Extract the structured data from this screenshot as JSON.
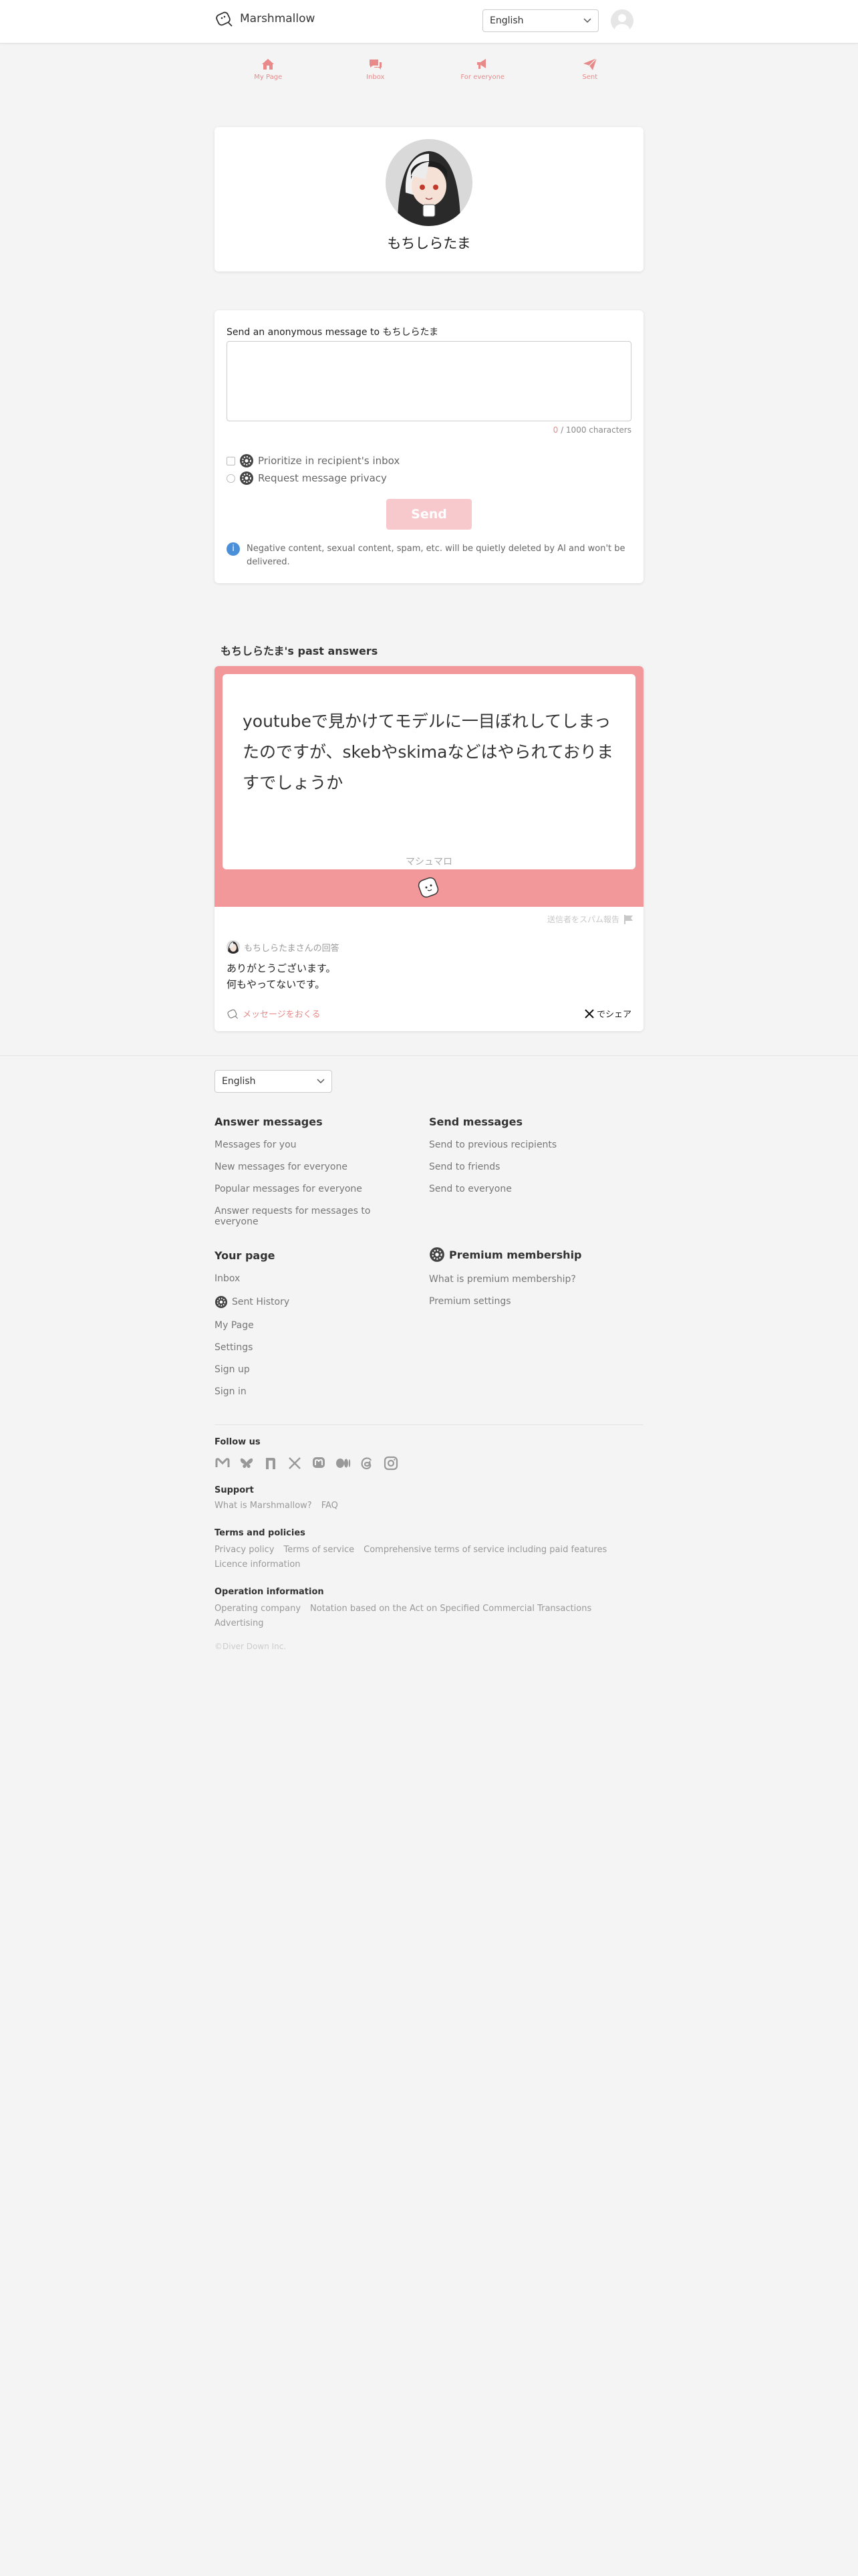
{
  "header": {
    "brand": "Marshmallow",
    "language": "English"
  },
  "tabs": [
    {
      "label": "My Page",
      "icon": "home-icon"
    },
    {
      "label": "Inbox",
      "icon": "inbox-icon"
    },
    {
      "label": "For everyone",
      "icon": "megaphone-icon"
    },
    {
      "label": "Sent",
      "icon": "send-icon"
    }
  ],
  "profile": {
    "name": "もちしらたま"
  },
  "form": {
    "label": "Send an anonymous message to もちしらたま",
    "textarea_value": "",
    "char_count": "0",
    "char_suffix": " / 1000 characters",
    "option_priority": "Prioritize in recipient's inbox",
    "option_privacy": "Request message privacy",
    "send_label": "Send",
    "notice": "Negative content, sexual content, spam, etc. will be quietly deleted by AI and won't be delivered."
  },
  "answers": {
    "section_title": "もちしらたま's past answers",
    "message": "youtubeで見かけてモデルに一目ぼれしてしまったのですが、skebやskimaなどはやられておりますでしょうか",
    "card_brand": "マシュマロ",
    "report_label": "送信者をスパム報告",
    "answerer_label": "もちしらたまさんの回答",
    "answer_text": "ありがとうございます。\n何もやってないです。",
    "reply_label": "メッセージをおくる",
    "share_label": "でシェア"
  },
  "footer": {
    "language": "English",
    "answer_messages": {
      "title": "Answer messages",
      "links": [
        "Messages for you",
        "New messages for everyone",
        "Popular messages for everyone",
        "Answer requests for messages to everyone"
      ]
    },
    "send_messages": {
      "title": "Send messages",
      "links": [
        "Send to previous recipients",
        "Send to friends",
        "Send to everyone"
      ]
    },
    "your_page": {
      "title": "Your page",
      "links": [
        "Inbox",
        "Sent History",
        "My Page",
        "Settings",
        "Sign up",
        "Sign in"
      ]
    },
    "premium": {
      "title": "Premium membership",
      "links": [
        "What is premium membership?",
        "Premium settings"
      ]
    },
    "follow_us": "Follow us",
    "social_icons": [
      "misskey-icon",
      "bluesky-icon",
      "note-icon",
      "x-icon",
      "mastodon-icon",
      "medium-icon",
      "threads-icon",
      "instagram-icon"
    ],
    "support": {
      "title": "Support",
      "links": [
        "What is Marshmallow?",
        "FAQ"
      ]
    },
    "terms": {
      "title": "Terms and policies",
      "links": [
        "Privacy policy",
        "Terms of service",
        "Comprehensive terms of service including paid features",
        "Licence information"
      ]
    },
    "operation": {
      "title": "Operation information",
      "links": [
        "Operating company",
        "Notation based on the Act on Specified Commercial Transactions",
        "Advertising"
      ]
    },
    "copyright": "©Diver Down Inc."
  },
  "colors": {
    "accent": "#e88a8a",
    "card_pink": "#f2989b",
    "send_disabled": "#f8c9cc",
    "info": "#4a90d9"
  }
}
